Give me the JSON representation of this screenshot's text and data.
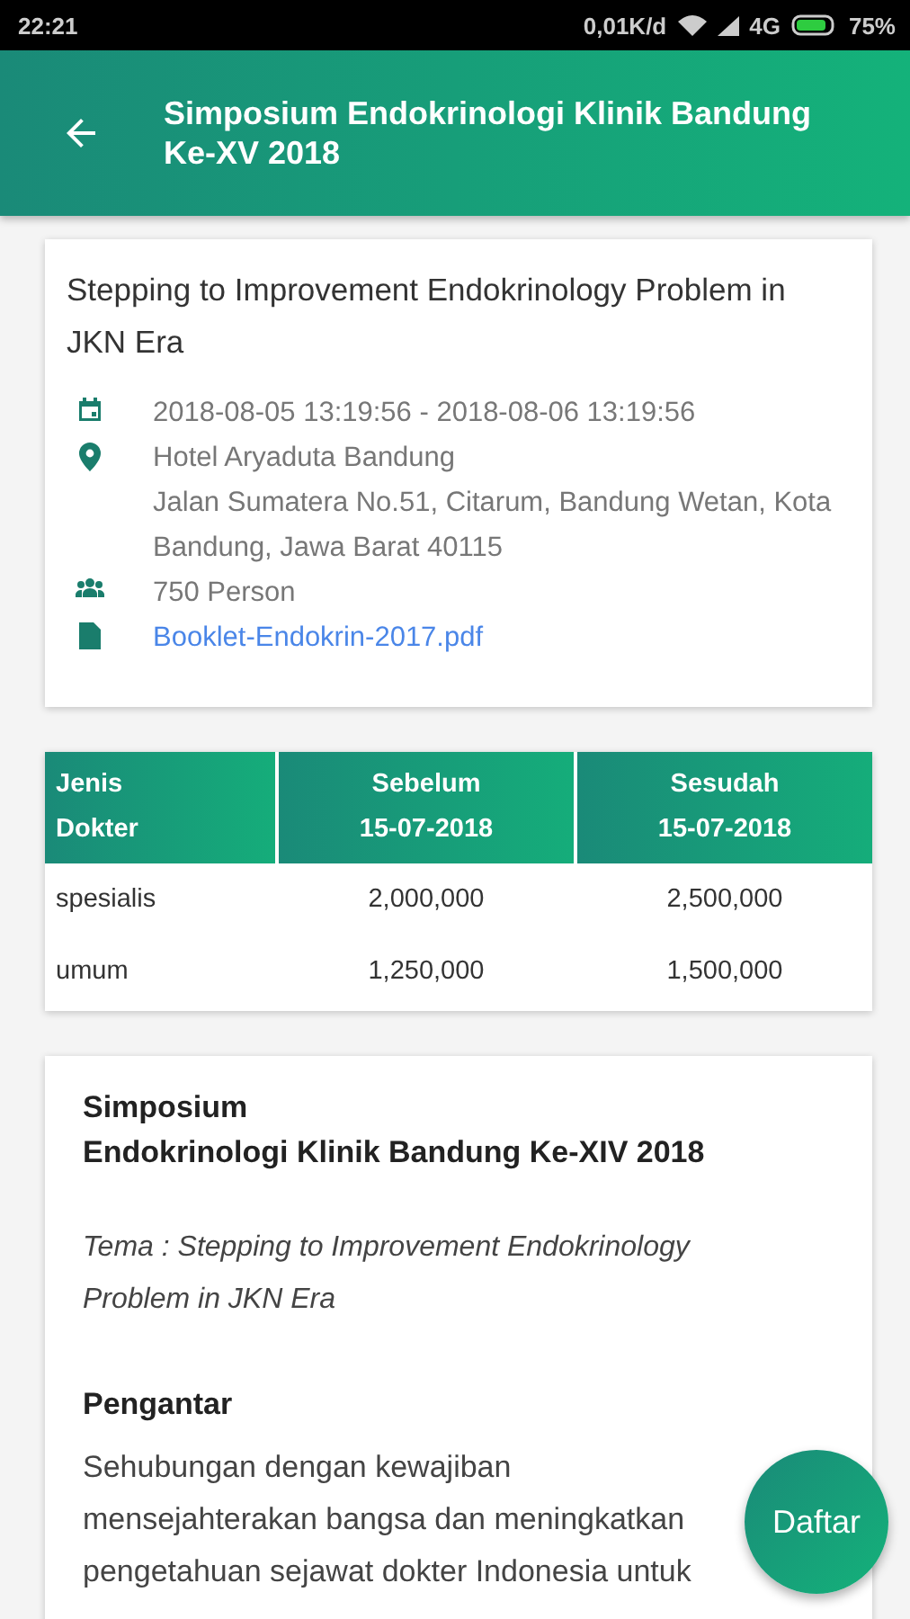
{
  "status_bar": {
    "time": "22:21",
    "speed": "0,01K/d",
    "network": "4G",
    "battery": "75%"
  },
  "app_bar": {
    "title": "Simposium Endokrinologi Klinik Bandung Ke-XV 2018"
  },
  "info_card": {
    "title": "Stepping to Improvement Endokrinology Problem in JKN Era",
    "details": [
      {
        "kind": "date",
        "lines": [
          "2018-08-05 13:19:56 - 2018-08-06 13:19:56"
        ]
      },
      {
        "kind": "location",
        "lines": [
          "Hotel Aryaduta Bandung",
          "Jalan Sumatera No.51, Citarum, Bandung Wetan, Kota Bandung, Jawa Barat 40115"
        ]
      },
      {
        "kind": "people",
        "lines": [
          "750 Person"
        ]
      },
      {
        "kind": "file",
        "lines": [
          "Booklet-Endokrin-2017.pdf"
        ]
      }
    ]
  },
  "price_table": {
    "columns": [
      "Jenis\nDokter",
      "Sebelum\n15-07-2018",
      "Sesudah\n15-07-2018"
    ],
    "rows": [
      [
        "spesialis",
        "2,000,000",
        "2,500,000"
      ],
      [
        "umum",
        "1,250,000",
        "1,500,000"
      ]
    ]
  },
  "description": {
    "title_lines": [
      "Simposium",
      "Endokrinologi Klinik Bandung Ke-XIV 2018"
    ],
    "theme": "Tema : Stepping to Improvement Endokrinology Problem in JKN Era",
    "heading": "Pengantar",
    "paragraph": "Sehubungan dengan kewajiban mensejahterakan bangsa dan meningkatkan pengetahuan sejawat dokter Indonesia untuk"
  },
  "fab": {
    "label": "Daftar"
  }
}
